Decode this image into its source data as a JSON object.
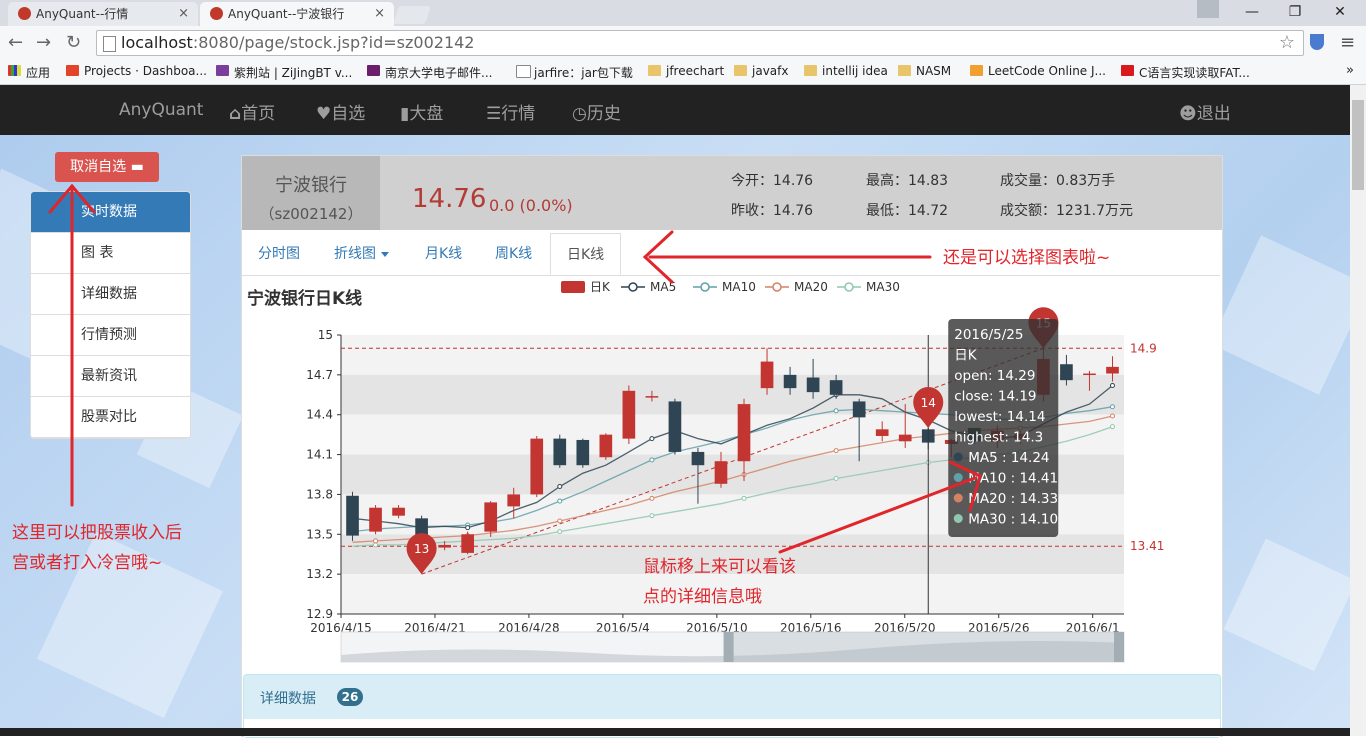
{
  "browser": {
    "tabs": [
      {
        "title": "AnyQuant--行情",
        "close": "×"
      },
      {
        "title": "AnyQuant--宁波银行",
        "close": "×"
      }
    ],
    "window_buttons": [
      "—",
      "❐",
      "✕"
    ],
    "url_host": "localhost",
    "url_rest": ":8080/page/stock.jsp?id=sz002142",
    "bookmarks": [
      "应用",
      "Projects · Dashboa...",
      "紫荆站 | ZiJingBT v...",
      "南京大学电子邮件...",
      "jarfire：jar包下载",
      "jfreechart",
      "javafx",
      "intellij idea",
      "NASM",
      "LeetCode Online J...",
      "C语言实现读取FAT..."
    ]
  },
  "nav": {
    "brand": "AnyQuant",
    "items": [
      {
        "icon": "home-icon",
        "label": "首页"
      },
      {
        "icon": "heart-icon",
        "label": "自选"
      },
      {
        "icon": "bar-chart-icon",
        "label": "大盘"
      },
      {
        "icon": "list-icon",
        "label": "行情"
      },
      {
        "icon": "clock-icon",
        "label": "历史"
      }
    ],
    "logout": "退出"
  },
  "sidebar": {
    "cancel_button": "取消自选",
    "items": [
      "实时数据",
      "图 表",
      "详细数据",
      "行情预测",
      "最新资讯",
      "股票对比"
    ]
  },
  "stock": {
    "name": "宁波银行",
    "code": "（sz002142）",
    "price": "14.76",
    "change": "0.0 (0.0%)",
    "quote": {
      "open": "今开：14.76",
      "high": "最高：14.83",
      "volume": "成交量：0.83万手",
      "prev_close": "昨收：14.76",
      "low": "最低：14.72",
      "turnover": "成交额：1231.7万元"
    }
  },
  "chart_tabs": [
    "分时图",
    "折线图",
    "月K线",
    "周K线",
    "日K线"
  ],
  "chart_title": "宁波银行日K线",
  "colors": {
    "up": "#c23531",
    "down": "#2f4554",
    "ma5": "#2f4554",
    "ma10": "#61a0a8",
    "ma20": "#d48265",
    "ma30": "#91c7ae",
    "accent": "#337ab7",
    "annotation": "#e0252b"
  },
  "chart_data": {
    "type": "candlestick",
    "title": "宁波银行日K线",
    "legend": [
      "日K",
      "MA5",
      "MA10",
      "MA20",
      "MA30"
    ],
    "x_ticks": [
      "2016/4/15",
      "2016/4/21",
      "2016/4/28",
      "2016/5/4",
      "2016/5/10",
      "2016/5/16",
      "2016/5/20",
      "2016/5/26",
      "2016/6/1"
    ],
    "y_ticks": [
      "15",
      "14.7",
      "14.4",
      "14.1",
      "13.8",
      "13.5",
      "13.2",
      "12.9"
    ],
    "ylim": [
      12.9,
      15
    ],
    "candles": [
      [
        13.79,
        13.49,
        13.45,
        13.82
      ],
      [
        13.52,
        13.7,
        13.5,
        13.72
      ],
      [
        13.64,
        13.7,
        13.62,
        13.72
      ],
      [
        13.62,
        13.38,
        13.32,
        13.64
      ],
      [
        13.4,
        13.42,
        13.38,
        13.45
      ],
      [
        13.36,
        13.5,
        13.35,
        13.52
      ],
      [
        13.52,
        13.74,
        13.48,
        13.75
      ],
      [
        13.71,
        13.8,
        13.62,
        13.85
      ],
      [
        13.8,
        14.22,
        13.78,
        14.24
      ],
      [
        14.22,
        14.02,
        14.0,
        14.25
      ],
      [
        14.21,
        14.02,
        14.0,
        14.22
      ],
      [
        14.08,
        14.25,
        14.06,
        14.26
      ],
      [
        14.22,
        14.58,
        14.18,
        14.62
      ],
      [
        14.54,
        14.54,
        14.5,
        14.58
      ],
      [
        14.5,
        14.12,
        14.1,
        14.52
      ],
      [
        14.12,
        14.02,
        13.73,
        14.15
      ],
      [
        13.88,
        14.05,
        13.85,
        14.12
      ],
      [
        14.05,
        14.48,
        13.9,
        14.52
      ],
      [
        14.6,
        14.8,
        14.55,
        14.9
      ],
      [
        14.7,
        14.6,
        14.55,
        14.76
      ],
      [
        14.68,
        14.57,
        14.52,
        14.82
      ],
      [
        14.66,
        14.55,
        14.52,
        14.7
      ],
      [
        14.5,
        14.38,
        14.05,
        14.52
      ],
      [
        14.24,
        14.29,
        14.2,
        14.35
      ],
      [
        14.2,
        14.25,
        14.15,
        14.48
      ],
      [
        14.29,
        14.19,
        14.14,
        14.3
      ],
      [
        14.18,
        14.21,
        14.08,
        14.22
      ],
      [
        14.3,
        14.2,
        14.18,
        14.3
      ],
      [
        14.2,
        14.28,
        14.15,
        14.32
      ],
      [
        14.22,
        14.25,
        14.18,
        14.28
      ],
      [
        14.55,
        14.82,
        14.5,
        14.9
      ],
      [
        14.78,
        14.66,
        14.62,
        14.85
      ],
      [
        14.7,
        14.71,
        14.58,
        14.73
      ],
      [
        14.71,
        14.76,
        14.65,
        14.84
      ]
    ],
    "ma5": [
      13.62,
      13.6,
      13.58,
      13.55,
      13.56,
      13.55,
      13.6,
      13.68,
      13.74,
      13.86,
      13.96,
      14.02,
      14.12,
      14.22,
      14.28,
      14.22,
      14.18,
      14.25,
      14.32,
      14.37,
      14.45,
      14.55,
      14.55,
      14.52,
      14.42,
      14.36,
      14.28,
      14.24,
      14.22,
      14.24,
      14.33,
      14.42,
      14.48,
      14.62
    ],
    "ma10": [
      13.52,
      13.54,
      13.55,
      13.56,
      13.56,
      13.57,
      13.59,
      13.62,
      13.68,
      13.75,
      13.82,
      13.9,
      13.98,
      14.06,
      14.12,
      14.16,
      14.2,
      14.25,
      14.3,
      14.36,
      14.4,
      14.43,
      14.44,
      14.43,
      14.42,
      14.41,
      14.4,
      14.38,
      14.37,
      14.36,
      14.38,
      14.41,
      14.43,
      14.46
    ],
    "ma20": [
      13.44,
      13.45,
      13.46,
      13.47,
      13.48,
      13.49,
      13.51,
      13.53,
      13.56,
      13.6,
      13.64,
      13.68,
      13.72,
      13.77,
      13.82,
      13.86,
      13.9,
      13.95,
      14.0,
      14.05,
      14.09,
      14.13,
      14.16,
      14.19,
      14.22,
      14.24,
      14.26,
      14.28,
      14.29,
      14.3,
      14.31,
      14.33,
      14.35,
      14.39
    ],
    "ma30": [
      13.41,
      13.42,
      13.42,
      13.43,
      13.44,
      13.45,
      13.46,
      13.47,
      13.49,
      13.52,
      13.55,
      13.58,
      13.61,
      13.64,
      13.67,
      13.7,
      13.73,
      13.77,
      13.81,
      13.85,
      13.88,
      13.92,
      13.95,
      13.98,
      14.01,
      14.04,
      14.06,
      14.08,
      14.1,
      14.12,
      14.16,
      14.2,
      14.25,
      14.31
    ],
    "mark_points": [
      {
        "label": "13",
        "index": 3,
        "value": 13.2
      },
      {
        "label": "14",
        "index": 25,
        "value": 14.3
      },
      {
        "label": "15",
        "index": 30,
        "value": 14.9
      }
    ],
    "mark_lines": [
      {
        "label": "14.9",
        "value": 14.9
      },
      {
        "label": "13.41",
        "value": 13.41
      }
    ],
    "trend_line": {
      "from_index": 3,
      "from_value": 13.2,
      "to_index": 30,
      "to_value": 14.9
    },
    "hover_index": 25,
    "tooltip": {
      "date": "2016/5/25",
      "series": "日K",
      "lines": [
        "open: 14.29",
        "close: 14.19",
        "lowest: 14.14",
        "highest: 14.3"
      ],
      "ma": [
        "MA5 : 14.24",
        "MA10 : 14.41",
        "MA20 : 14.33",
        "MA30 : 14.10"
      ]
    },
    "datazoom": {
      "start": 0.0,
      "end": 1.0
    }
  },
  "details": {
    "title": "详细数据",
    "count": "26"
  },
  "annotations": {
    "left": [
      "这里可以把股票收入后",
      "宫或者打入冷宫哦~"
    ],
    "top": "还是可以选择图表啦~",
    "mid": [
      "鼠标移上来可以看该",
      "点的详细信息哦"
    ]
  }
}
